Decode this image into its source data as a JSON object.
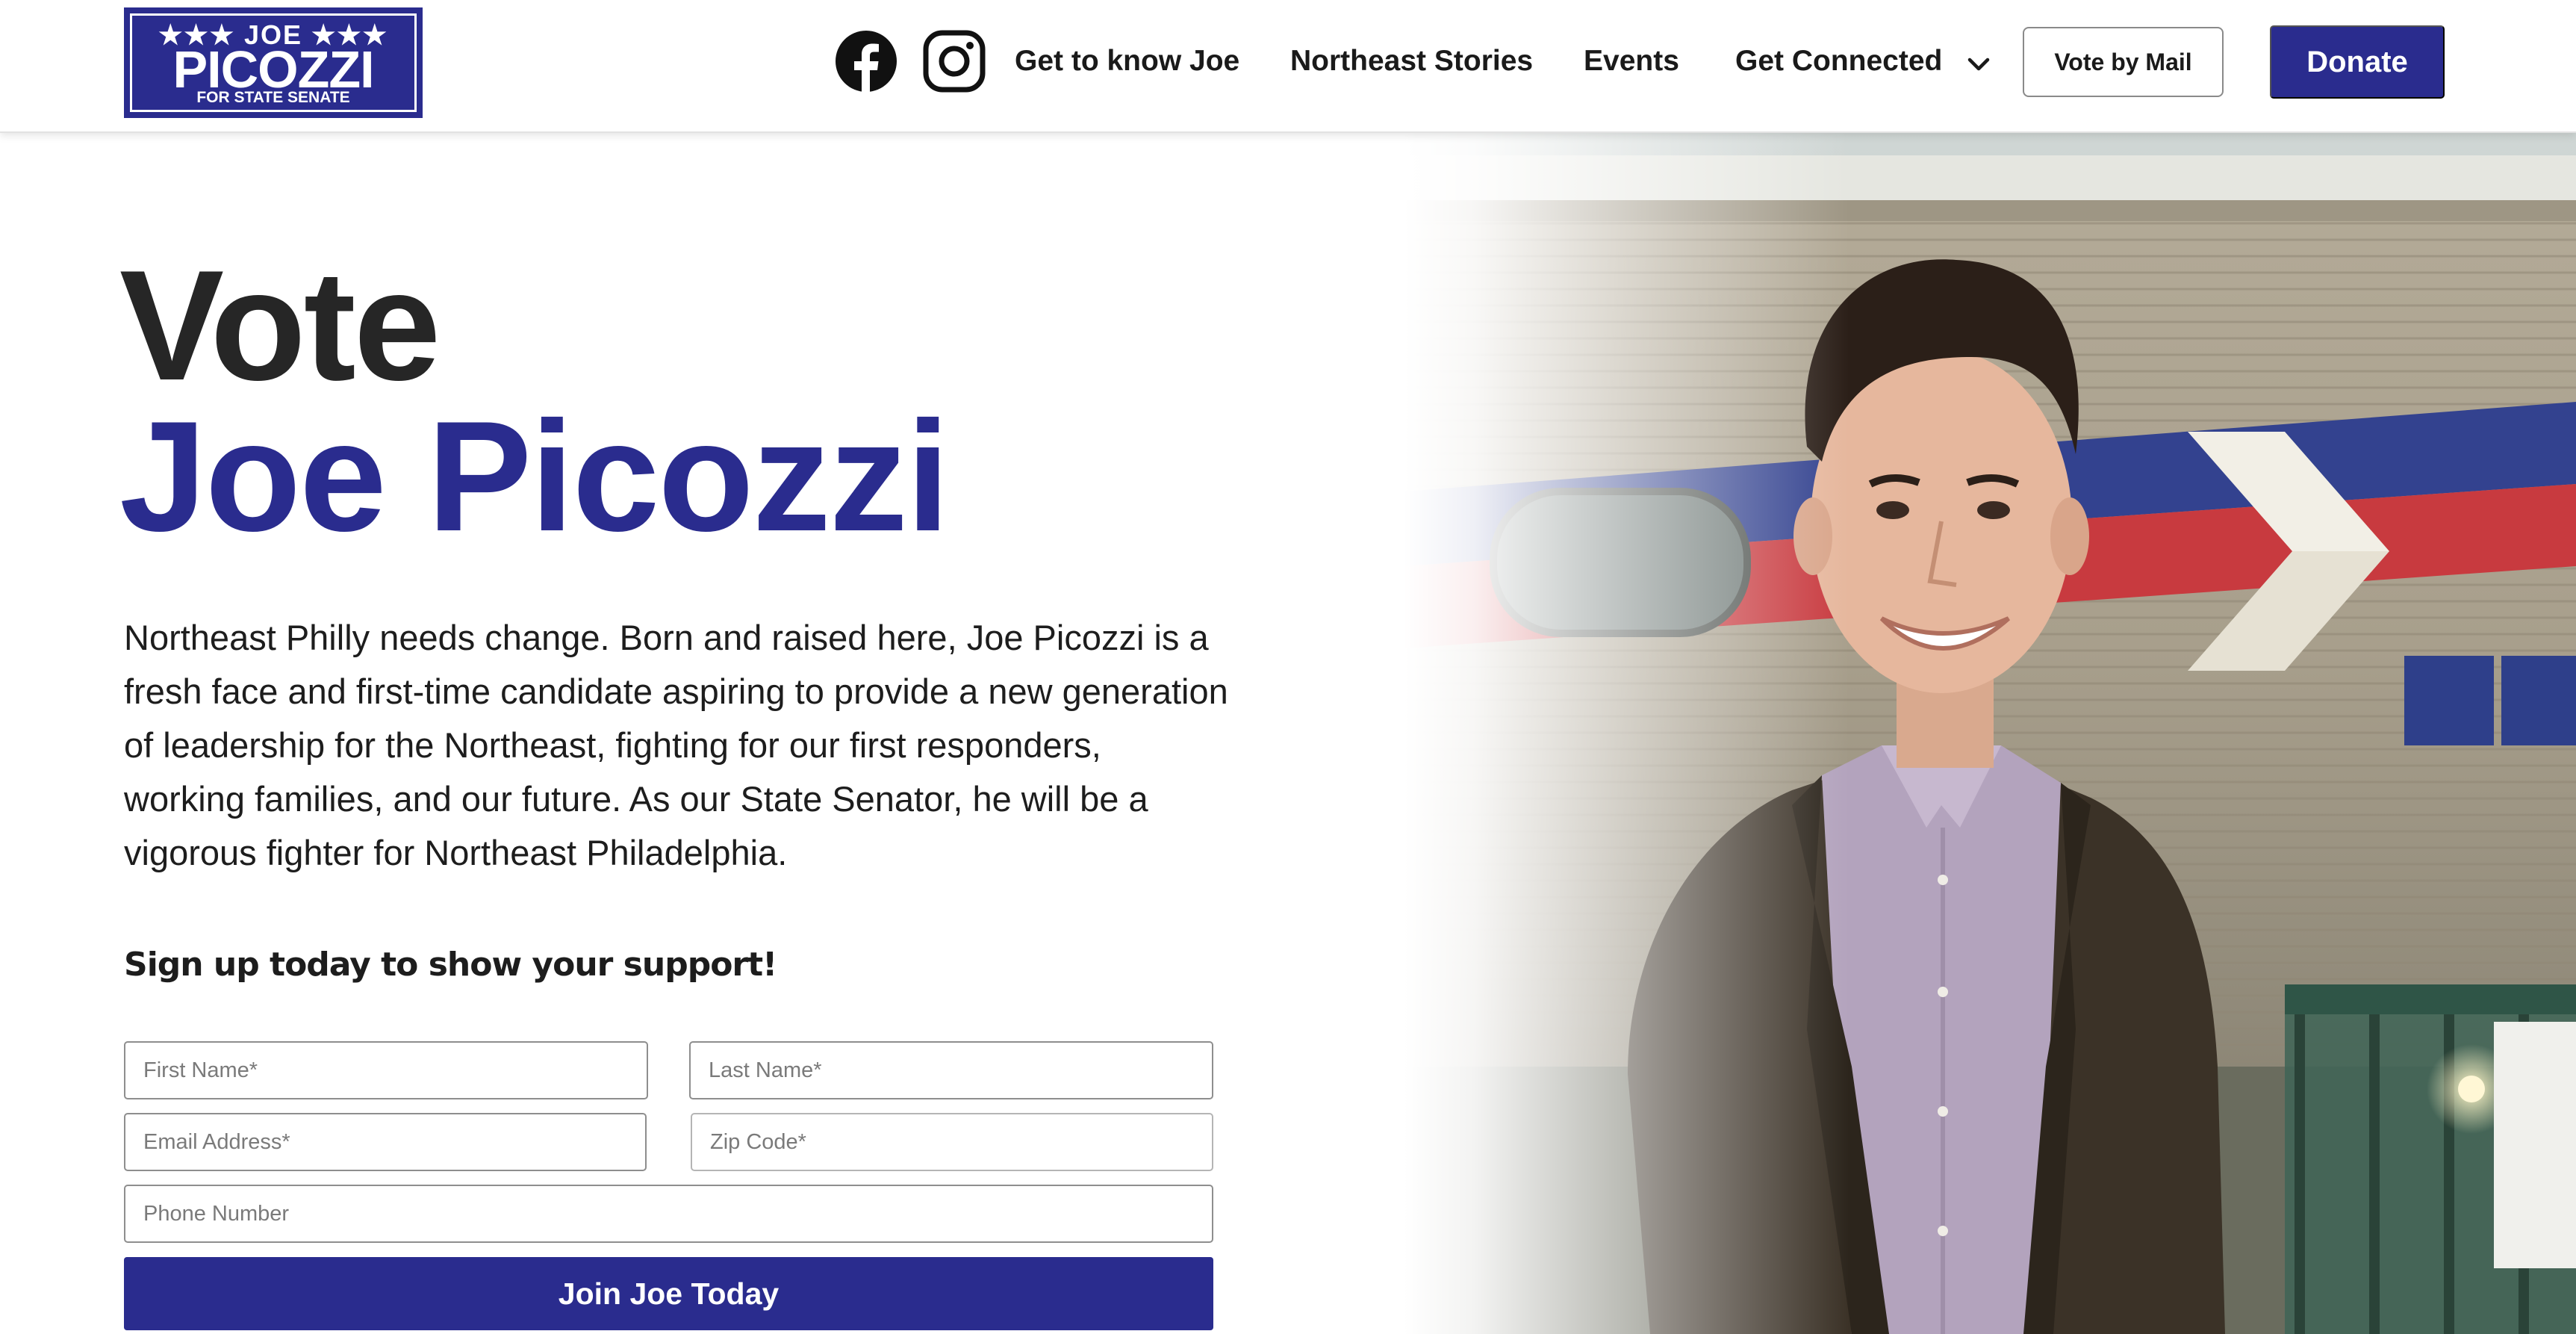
{
  "logo": {
    "top": "★★★ JOE ★★★",
    "main": "PICOZZI",
    "sub": "FOR STATE SENATE"
  },
  "nav": {
    "social": [
      "facebook-icon",
      "instagram-icon"
    ],
    "links": [
      "Get to know Joe",
      "Northeast Stories",
      "Events",
      "Get Connected"
    ],
    "vote_by_mail": "Vote by Mail",
    "donate": "Donate"
  },
  "hero": {
    "headline_line1": "Vote",
    "headline_line2": "Joe Picozzi",
    "intro": "Northeast Philly needs change. Born and raised here, Joe Picozzi is a fresh face and first-time candidate aspiring to provide a new generation of leadership for the Northeast, fighting for our first responders, working families, and our future. As our State Senator, he will be a vigorous fighter for Northeast Philadelphia."
  },
  "signup": {
    "heading": "Sign up today to show your support!",
    "first_name": "First Name*",
    "last_name": "Last Name*",
    "email": "Email Address*",
    "zip": "Zip Code*",
    "phone": "Phone Number",
    "submit": "Join Joe Today"
  },
  "colors": {
    "brand_blue": "#2a2c8e",
    "headline_dark": "#262626"
  }
}
